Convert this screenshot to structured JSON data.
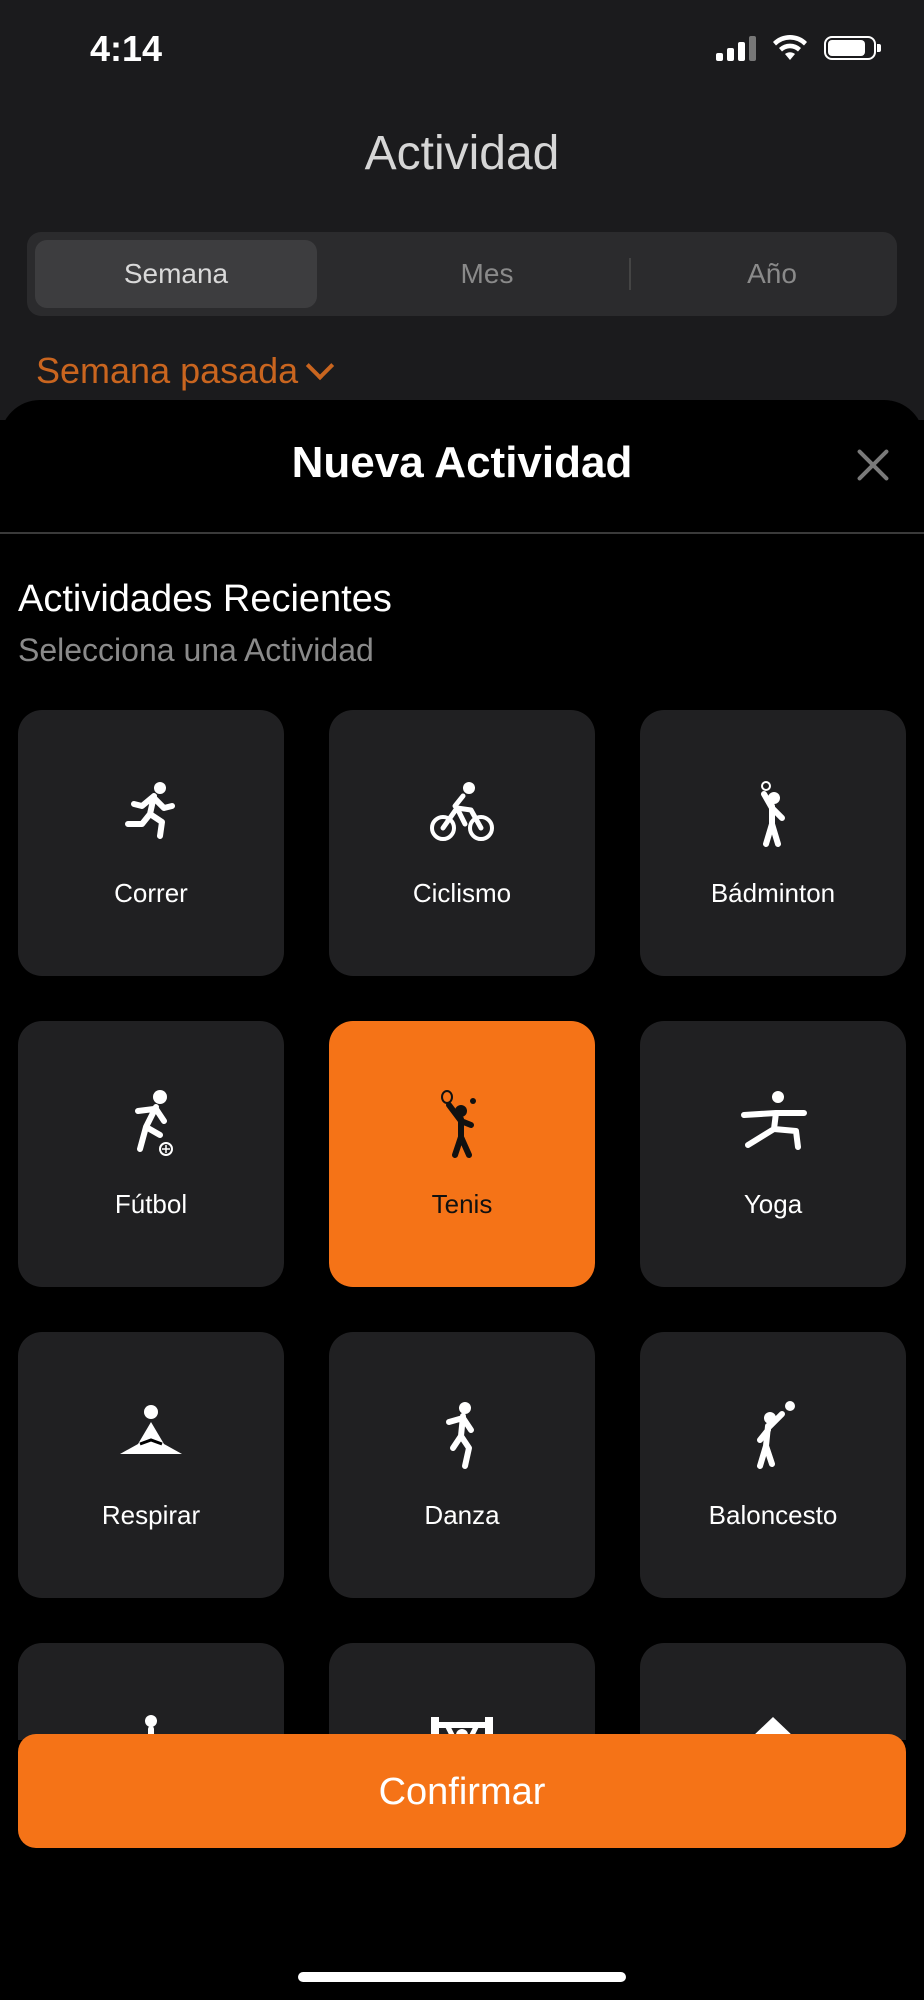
{
  "status": {
    "time": "4:14",
    "battery_level": 0.85
  },
  "header": {
    "title": "Actividad"
  },
  "segments": [
    {
      "label": "Semana",
      "active": true
    },
    {
      "label": "Mes",
      "active": false
    },
    {
      "label": "Año",
      "active": false
    }
  ],
  "period": {
    "label": "Semana pasada"
  },
  "sheet": {
    "title": "Nueva Actividad",
    "section_title": "Actividades Recientes",
    "section_subtitle": "Selecciona una Actividad",
    "confirm_label": "Confirmar"
  },
  "activities": [
    {
      "label": "Correr",
      "icon": "running-icon",
      "selected": false
    },
    {
      "label": "Ciclismo",
      "icon": "cycling-icon",
      "selected": false
    },
    {
      "label": "Bádminton",
      "icon": "badminton-icon",
      "selected": false
    },
    {
      "label": "Fútbol",
      "icon": "soccer-icon",
      "selected": false
    },
    {
      "label": "Tenis",
      "icon": "tennis-icon",
      "selected": true
    },
    {
      "label": "Yoga",
      "icon": "yoga-icon",
      "selected": false
    },
    {
      "label": "Respirar",
      "icon": "meditation-icon",
      "selected": false
    },
    {
      "label": "Danza",
      "icon": "dance-icon",
      "selected": false
    },
    {
      "label": "Baloncesto",
      "icon": "basketball-icon",
      "selected": false
    },
    {
      "label": "",
      "icon": "person-icon",
      "selected": false
    },
    {
      "label": "",
      "icon": "weightlifting-icon",
      "selected": false
    },
    {
      "label": "",
      "icon": "shape-icon",
      "selected": false
    }
  ],
  "colors": {
    "accent": "#f57317",
    "tile_bg": "#202022",
    "period_text": "#c9651f"
  }
}
